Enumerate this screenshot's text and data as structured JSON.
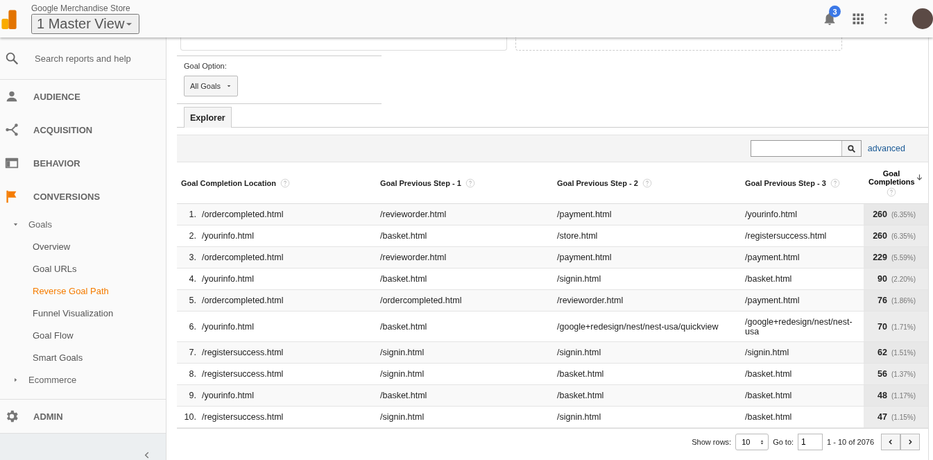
{
  "header": {
    "account": "Google Merchandise Store",
    "view": "1 Master View",
    "notification_count": "3"
  },
  "sidebar": {
    "search": {
      "placeholder": "Search reports and help"
    },
    "sections": [
      {
        "label": "AUDIENCE",
        "selected": false
      },
      {
        "label": "ACQUISITION",
        "selected": false
      },
      {
        "label": "BEHAVIOR",
        "selected": false
      },
      {
        "label": "CONVERSIONS",
        "selected": true,
        "children": [
          {
            "label": "Goals",
            "expanded": true,
            "children": [
              {
                "label": "Overview",
                "selected": false
              },
              {
                "label": "Goal URLs",
                "selected": false
              },
              {
                "label": "Reverse Goal Path",
                "selected": true
              },
              {
                "label": "Funnel Visualization",
                "selected": false
              },
              {
                "label": "Goal Flow",
                "selected": false
              },
              {
                "label": "Smart Goals",
                "selected": false
              }
            ]
          },
          {
            "label": "Ecommerce",
            "expanded": false
          }
        ]
      }
    ],
    "admin": "ADMIN"
  },
  "report": {
    "goal_option": {
      "label": "Goal Option:",
      "value": "All Goals"
    },
    "tabs": [
      {
        "label": "Explorer",
        "selected": true
      }
    ],
    "advanced_link": "advanced",
    "table": {
      "columns": [
        {
          "label": "Goal Completion Location",
          "sorted": false
        },
        {
          "label": "Goal Previous Step - 1",
          "sorted": false
        },
        {
          "label": "Goal Previous Step - 2",
          "sorted": false
        },
        {
          "label": "Goal Previous Step - 3",
          "sorted": false
        },
        {
          "label": "Goal Completions",
          "sorted": true
        }
      ],
      "rows": [
        {
          "index": "1.",
          "location": "/ordercompleted.html",
          "step_1": "/revieworder.html",
          "step_2": "/payment.html",
          "step_3": "/yourinfo.html",
          "completions": "260",
          "share": "(6.35%)"
        },
        {
          "index": "2.",
          "location": "/yourinfo.html",
          "step_1": "/basket.html",
          "step_2": "/store.html",
          "step_3": "/registersuccess.html",
          "completions": "260",
          "share": "(6.35%)"
        },
        {
          "index": "3.",
          "location": "/ordercompleted.html",
          "step_1": "/revieworder.html",
          "step_2": "/payment.html",
          "step_3": "/payment.html",
          "completions": "229",
          "share": "(5.59%)"
        },
        {
          "index": "4.",
          "location": "/yourinfo.html",
          "step_1": "/basket.html",
          "step_2": "/signin.html",
          "step_3": "/basket.html",
          "completions": "90",
          "share": "(2.20%)"
        },
        {
          "index": "5.",
          "location": "/ordercompleted.html",
          "step_1": "/ordercompleted.html",
          "step_2": "/revieworder.html",
          "step_3": "/payment.html",
          "completions": "76",
          "share": "(1.86%)"
        },
        {
          "index": "6.",
          "location": "/yourinfo.html",
          "step_1": "/basket.html",
          "step_2": "/google+redesign/nest/nest-usa/quickview",
          "step_3": "/google+redesign/nest/nest-usa",
          "completions": "70",
          "share": "(1.71%)"
        },
        {
          "index": "7.",
          "location": "/registersuccess.html",
          "step_1": "/signin.html",
          "step_2": "/signin.html",
          "step_3": "/signin.html",
          "completions": "62",
          "share": "(1.51%)"
        },
        {
          "index": "8.",
          "location": "/registersuccess.html",
          "step_1": "/signin.html",
          "step_2": "/basket.html",
          "step_3": "/basket.html",
          "completions": "56",
          "share": "(1.37%)"
        },
        {
          "index": "9.",
          "location": "/yourinfo.html",
          "step_1": "/basket.html",
          "step_2": "/basket.html",
          "step_3": "/basket.html",
          "completions": "48",
          "share": "(1.17%)"
        },
        {
          "index": "10.",
          "location": "/registersuccess.html",
          "step_1": "/signin.html",
          "step_2": "/signin.html",
          "step_3": "/basket.html",
          "completions": "47",
          "share": "(1.15%)"
        }
      ]
    },
    "pagination": {
      "show_rows_label": "Show rows:",
      "rows_value": "10",
      "goto_label": "Go to:",
      "goto_value": "1",
      "range": "1 - 10 of 2076"
    }
  }
}
